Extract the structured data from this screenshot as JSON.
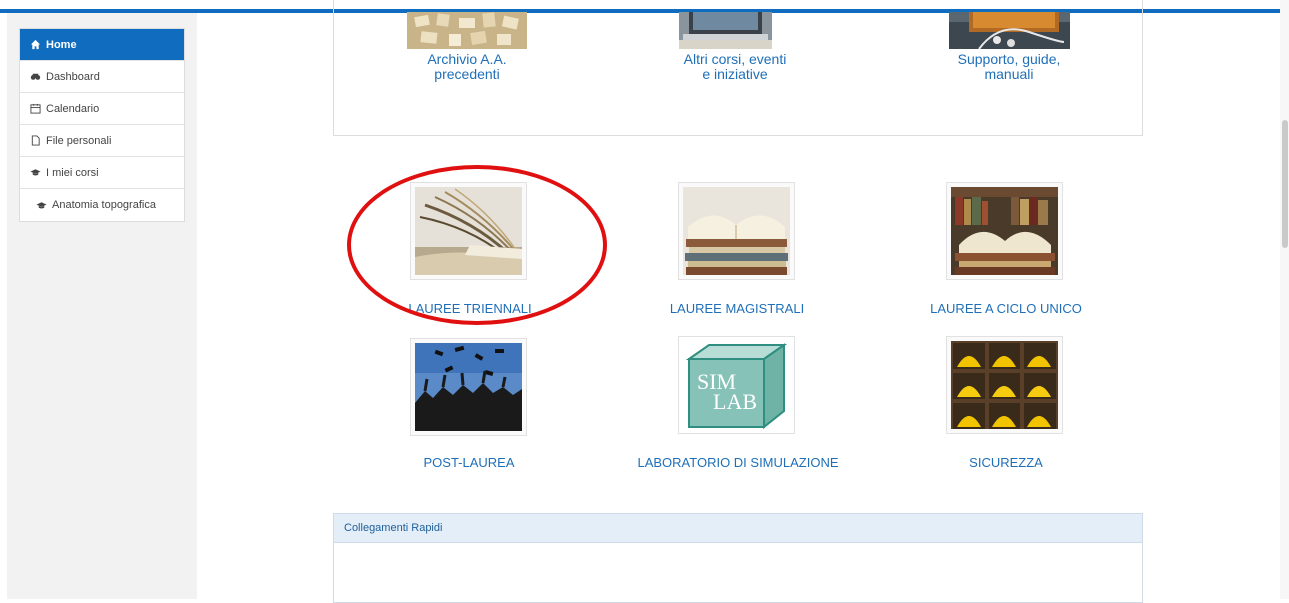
{
  "nav": {
    "items": [
      {
        "label": "Home",
        "icon": "home-icon",
        "active": true
      },
      {
        "label": "Dashboard",
        "icon": "dashboard-icon",
        "active": false
      },
      {
        "label": "Calendario",
        "icon": "calendar-icon",
        "active": false
      },
      {
        "label": "File personali",
        "icon": "file-icon",
        "active": false
      },
      {
        "label": "I miei corsi",
        "icon": "graduation-cap-icon",
        "active": false
      },
      {
        "label": "Anatomia topografica",
        "icon": "graduation-cap-icon",
        "active": false
      }
    ]
  },
  "top_tiles": [
    {
      "label": "Archivio A.A.\nprecedenti"
    },
    {
      "label": "Altri corsi, eventi\ne iniziative"
    },
    {
      "label": "Supporto, guide,\nmanuali"
    }
  ],
  "tiles": [
    {
      "label": "LAUREE TRIENNALI"
    },
    {
      "label": "LAUREE MAGISTRALI"
    },
    {
      "label": "LAUREE A CICLO UNICO"
    },
    {
      "label": "POST-LAUREA"
    },
    {
      "label": "LABORATORIO DI SIMULAZIONE"
    },
    {
      "label": "SICUREZZA"
    }
  ],
  "simlab_text": {
    "line1": "SIM",
    "line2": "LAB"
  },
  "quick_links": {
    "title": "Collegamenti Rapidi"
  },
  "colors": {
    "accent": "#0f6cbf",
    "link": "#1f6fb8",
    "highlight_circle": "#e01010"
  }
}
